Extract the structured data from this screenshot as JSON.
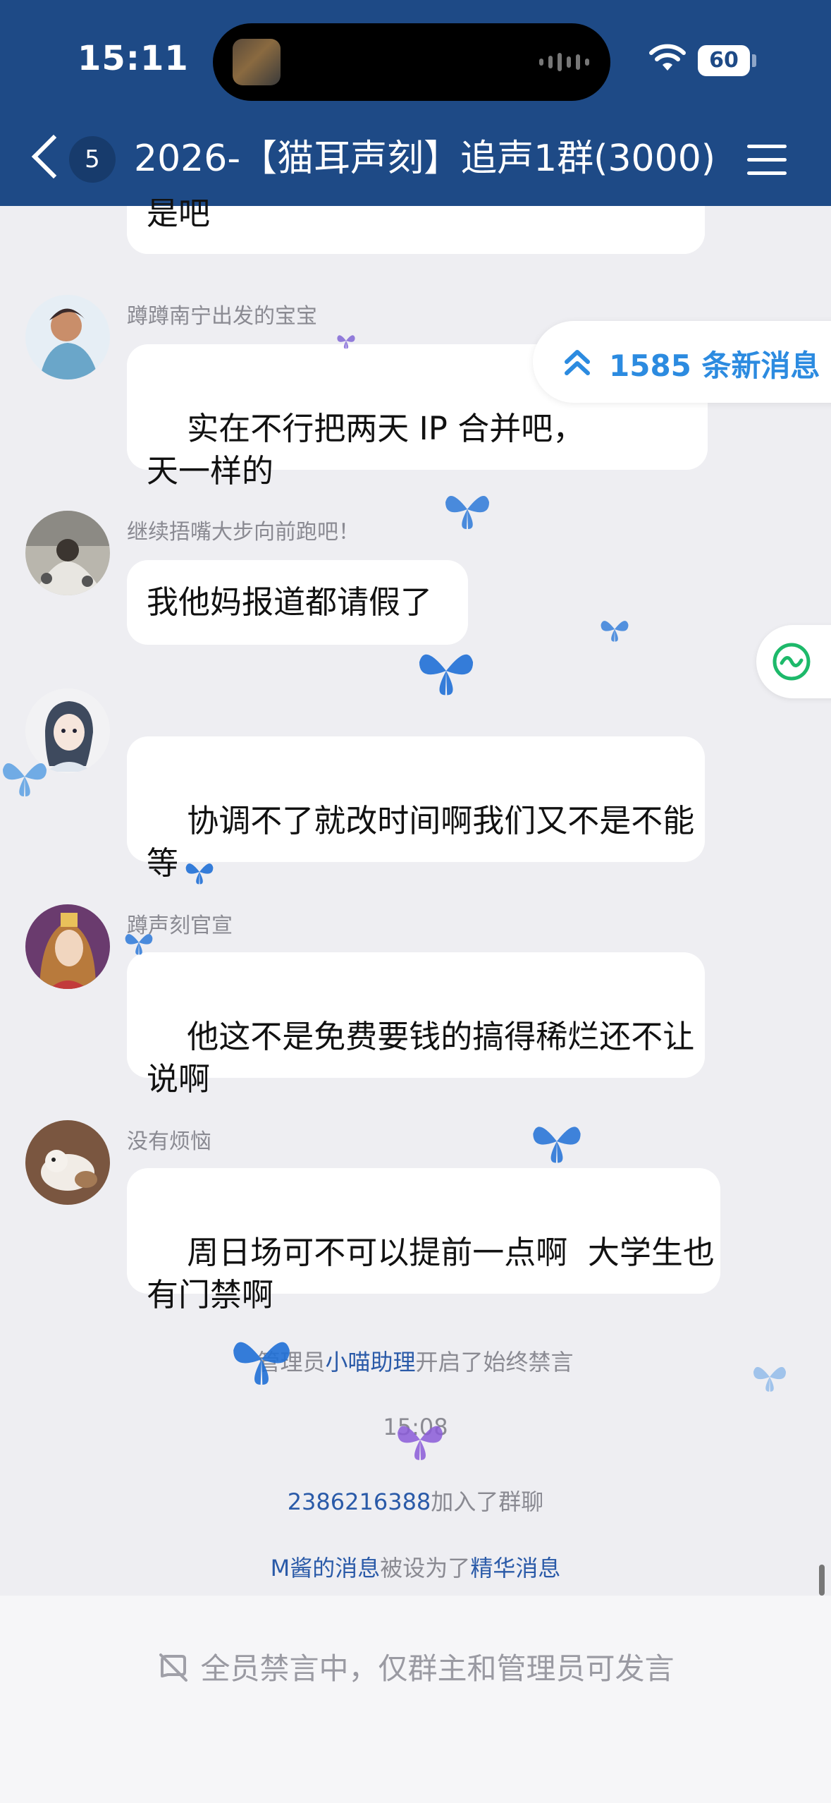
{
  "status_bar": {
    "time": "15:11",
    "battery": "60"
  },
  "header": {
    "unread_count": "5",
    "title": "2026-【猫耳声刻】追声1群(3000)"
  },
  "new_messages": {
    "label": "1585 条新消息"
  },
  "messages": [
    {
      "sender": "",
      "text": "是吧"
    },
    {
      "sender": "蹲蹲南宁出发的宝宝",
      "text": "实在不行把两天 IP 合并吧，\n天一样的"
    },
    {
      "sender": "继续捂嘴大步向前跑吧！",
      "text": "我他妈报道都请假了"
    },
    {
      "sender": "",
      "text": "协调不了就改时间啊我们又不是不能\n等"
    },
    {
      "sender": "蹲声刻官宣",
      "text": "他这不是免费要钱的搞得稀烂还不让\n说啊"
    },
    {
      "sender": "没有烦恼",
      "text": "周日场可不可以提前一点啊  大学生也\n有门禁啊"
    }
  ],
  "system_messages": {
    "mute": {
      "prefix": "管理员",
      "admin": "小喵助理",
      "suffix": "开启了始终禁言"
    },
    "timestamp": "15:08",
    "join": {
      "user": "2386216388",
      "suffix": "加入了群聊"
    },
    "essence": {
      "msg": "M酱的消息",
      "middle": "被设为了",
      "tag": "精华消息"
    }
  },
  "bottom": {
    "muted_notice": "全员禁言中，仅群主和管理员可发言"
  },
  "colors": {
    "header": "#1E4A86",
    "accent": "#2C8BE0",
    "link": "#2A5AA8",
    "chat_bg": "#EEEEF2"
  },
  "icons": [
    "back-chevron-icon",
    "menu-icon",
    "double-chevron-up-icon",
    "wifi-icon",
    "muted-icon",
    "butterfly-decoration"
  ]
}
